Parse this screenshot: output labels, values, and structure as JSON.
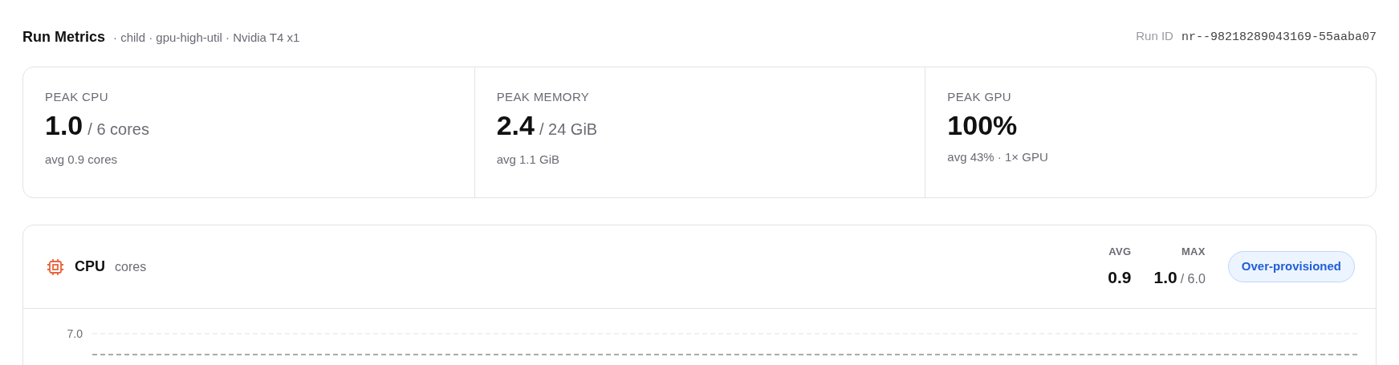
{
  "header": {
    "title": "Run Metrics",
    "meta": "· child · gpu-high-util · Nvidia T4 x1",
    "run_id_label": "Run ID",
    "run_id": "nr--98218289043169-55aaba07"
  },
  "stats": [
    {
      "label": "PEAK CPU",
      "value": "1.0",
      "unit": "/ 6 cores",
      "sub": "avg 0.9 cores"
    },
    {
      "label": "PEAK MEMORY",
      "value": "2.4",
      "unit": "/ 24 GiB",
      "sub": "avg 1.1 GiB"
    },
    {
      "label": "PEAK GPU",
      "value": "100%",
      "sub": "avg 43% · 1× GPU"
    }
  ],
  "cpu_panel": {
    "title": "CPU",
    "unit": "cores",
    "avg_label": "AVG",
    "avg": "0.9",
    "max_label": "MAX",
    "max": "1.0",
    "max_limit": "/ 6.0",
    "badge": "Over-provisioned",
    "ytick": "7.0"
  }
}
